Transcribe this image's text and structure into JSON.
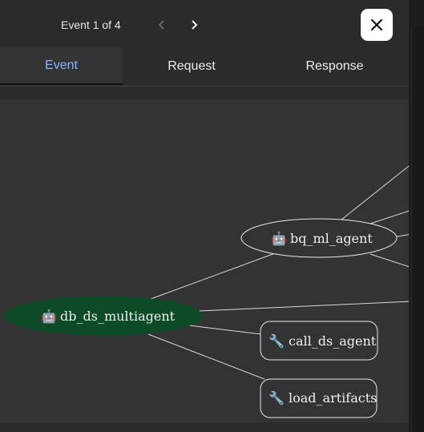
{
  "header": {
    "event_counter": "Event 1 of 4"
  },
  "tabs": [
    {
      "label": "Event",
      "active": true
    },
    {
      "label": "Request",
      "active": false
    },
    {
      "label": "Response",
      "active": false
    }
  ],
  "graph": {
    "nodes": [
      {
        "id": "bq",
        "label": "bq_ml_agent",
        "icon": "robot-icon",
        "kind": "agent"
      },
      {
        "id": "db",
        "label": "db_ds_multiagent",
        "icon": "robot-icon",
        "kind": "agent",
        "highlighted": true
      },
      {
        "id": "call",
        "label": "call_ds_agent",
        "icon": "wrench-icon",
        "kind": "tool"
      },
      {
        "id": "load",
        "label": "load_artifacts",
        "icon": "wrench-icon",
        "kind": "tool"
      }
    ],
    "colors": {
      "highlight_fill": "#0d4a26",
      "edge": "#d9d9d9",
      "node_stroke": "#e8e8e8"
    }
  }
}
